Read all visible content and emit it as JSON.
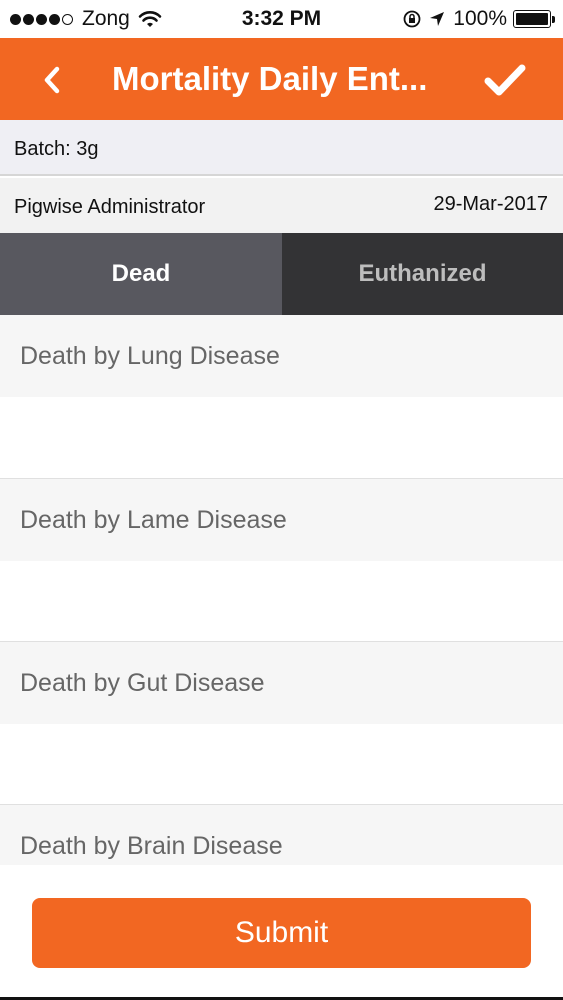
{
  "status_bar": {
    "carrier": "Zong",
    "time": "3:32 PM",
    "battery": "100%",
    "icons": [
      "signal-icon",
      "wifi-icon",
      "orientation-lock-icon",
      "location-arrow-icon",
      "battery-icon"
    ]
  },
  "nav": {
    "title": "Mortality Daily Ent...",
    "back_icon": "chevron-left-icon",
    "confirm_icon": "checkmark-icon",
    "color": "#f26722"
  },
  "batch": {
    "label": "Batch: 3g"
  },
  "user": {
    "name": "Pigwise Administrator",
    "date": "29-Mar-2017"
  },
  "tabs": [
    {
      "label": "Dead",
      "selected": true
    },
    {
      "label": "Euthanized",
      "selected": false
    }
  ],
  "diseases": [
    {
      "label": "Death by Lung Disease",
      "value": ""
    },
    {
      "label": "Death by Lame Disease",
      "value": ""
    },
    {
      "label": "Death by Gut Disease",
      "value": ""
    },
    {
      "label": "Death by Brain Disease",
      "value": ""
    }
  ],
  "footer": {
    "submit_label": "Submit"
  },
  "colors": {
    "accent": "#f26722",
    "tab_selected": "#58585f",
    "tab_unselected": "#333335"
  }
}
